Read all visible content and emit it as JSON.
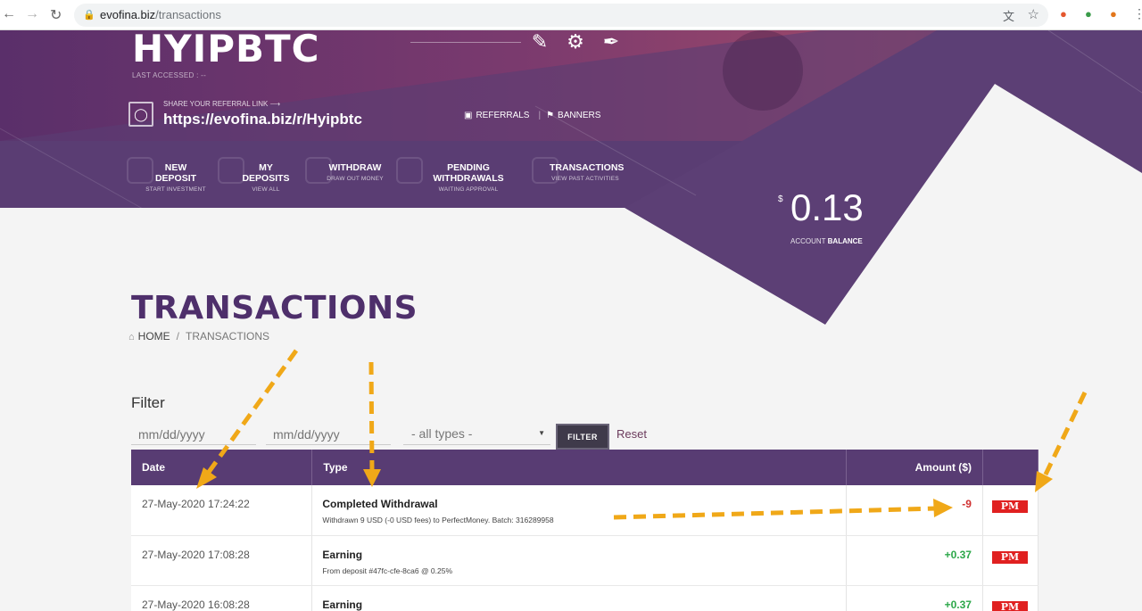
{
  "browser": {
    "url_host": "evofina.biz",
    "url_path": "/transactions"
  },
  "header": {
    "brand": "HYIPBTC",
    "last_accessed": "LAST ACCESSED : --",
    "referral_caption": "SHARE YOUR REFERRAL LINK ⟶",
    "referral_link": "https://evofina.biz/r/Hyipbtc",
    "referrals_label": "REFERRALS",
    "banners_label": "BANNERS"
  },
  "menu": [
    {
      "label": "NEW DEPOSIT",
      "sub": "START INVESTMENT"
    },
    {
      "label": "MY DEPOSITS",
      "sub": "VIEW ALL"
    },
    {
      "label": "WITHDRAW",
      "sub": "DRAW OUT MONEY"
    },
    {
      "label": "PENDING WITHDRAWALS",
      "sub": "WAITING APPROVAL"
    },
    {
      "label": "TRANSACTIONS",
      "sub": "VIEW PAST ACTIVITIES"
    }
  ],
  "balance": {
    "currency": "$",
    "value": "0.13",
    "caption_prefix": "ACCOUNT",
    "caption_bold": "BALANCE"
  },
  "page": {
    "title": "TRANSACTIONS",
    "breadcrumb_home": "HOME",
    "breadcrumb_sep": "/",
    "breadcrumb_current": "TRANSACTIONS"
  },
  "filter": {
    "title": "Filter",
    "date_placeholder": "mm/dd/yyyy",
    "type_selected": "- all types -",
    "button": "FILTER",
    "reset": "Reset"
  },
  "table": {
    "headers": [
      "Date",
      "Type",
      "Amount ($)"
    ],
    "rows": [
      {
        "date": "27-May-2020 17:24:22",
        "type": "Completed Withdrawal",
        "desc": "Withdrawn 9 USD (-0 USD fees) to PerfectMoney. Batch: 316289958",
        "amount": "-9",
        "processor": "PM"
      },
      {
        "date": "27-May-2020 17:08:28",
        "type": "Earning",
        "desc": "From deposit #47fc-cfe-8ca6 @ 0.25%",
        "amount": "+0.37",
        "processor": "PM"
      },
      {
        "date": "27-May-2020 16:08:28",
        "type": "Earning",
        "desc": "",
        "amount": "+0.37",
        "processor": "PM"
      }
    ]
  },
  "colors": {
    "brand_purple": "#583c73",
    "title_purple": "#4e2f6b",
    "negative": "#d03030",
    "positive": "#2da84a",
    "arrow": "#f0a818",
    "pm_red": "#e02020"
  }
}
